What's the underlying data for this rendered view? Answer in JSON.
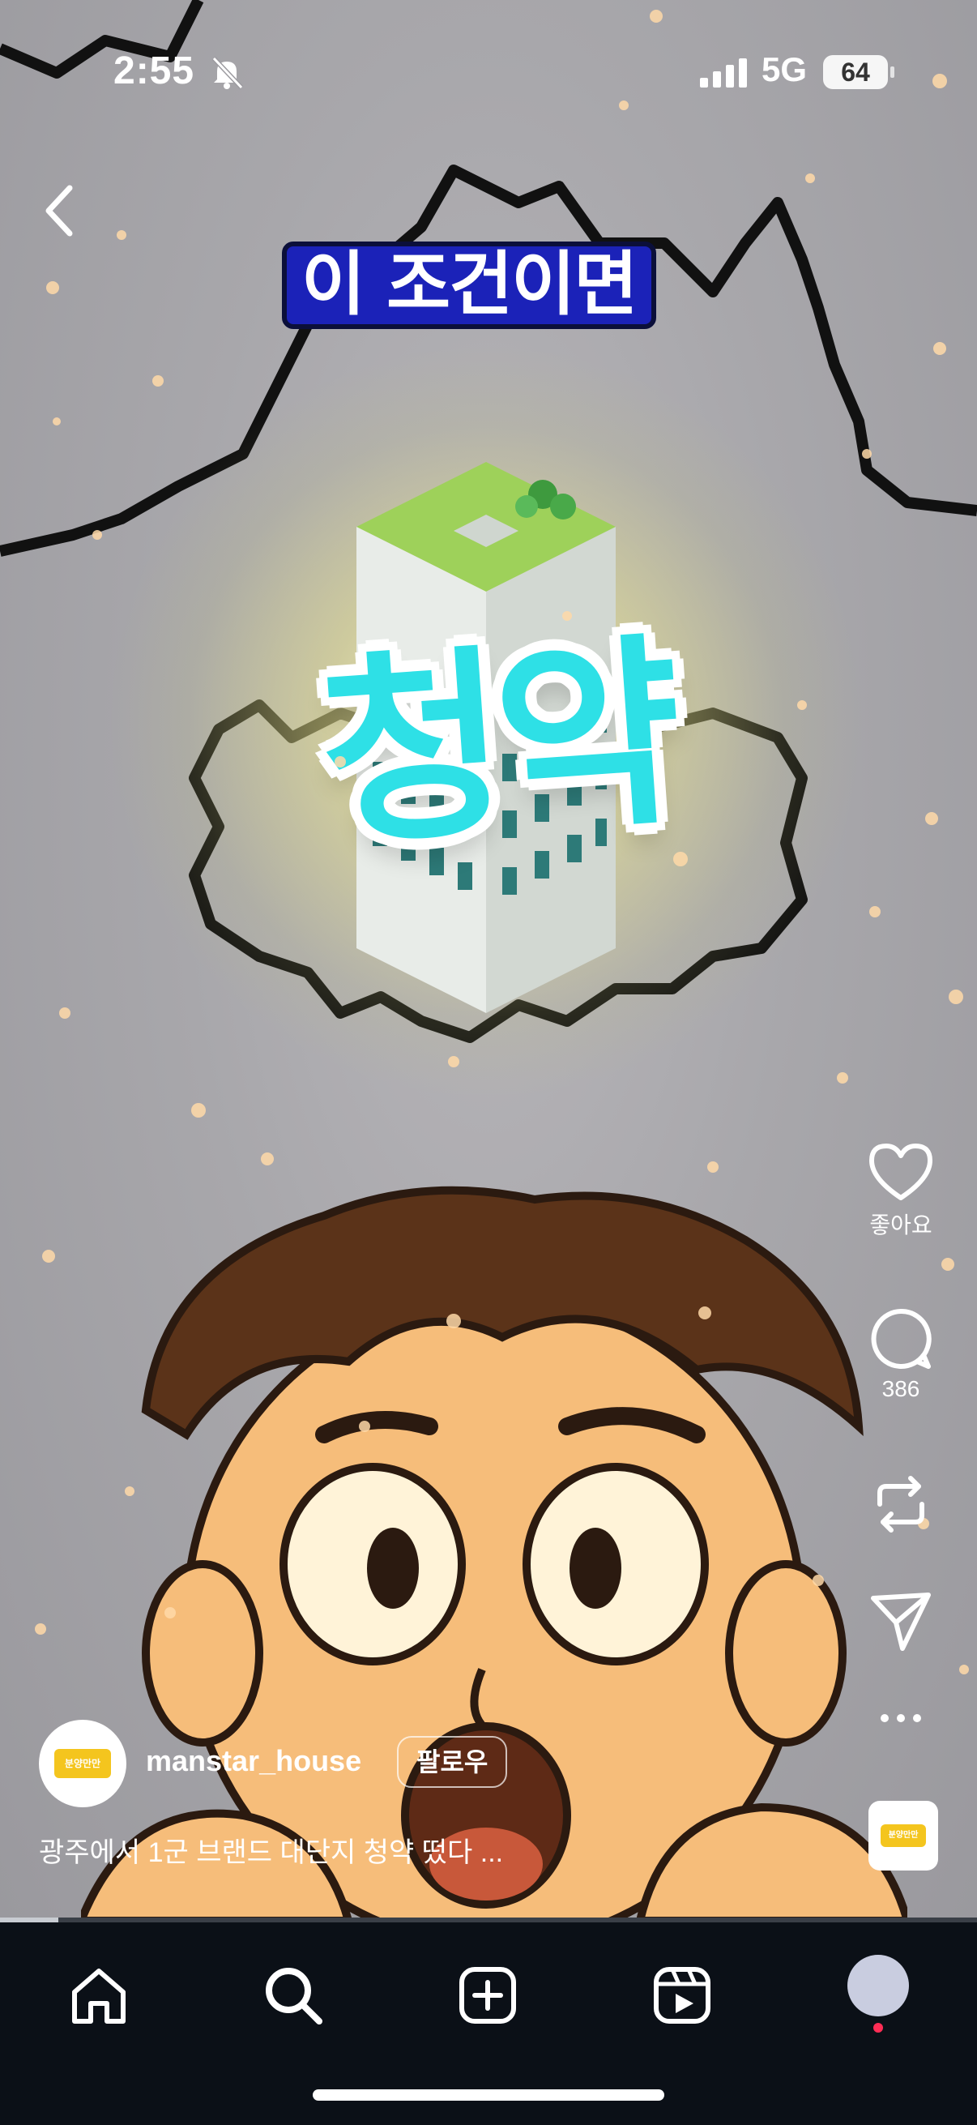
{
  "status_bar": {
    "time": "2:55",
    "network": "5G",
    "battery": "64"
  },
  "video": {
    "headline": "이 조건이면",
    "big_word": "청약"
  },
  "actions": {
    "like_label": "좋아요",
    "comment_count": "386"
  },
  "post": {
    "username": "manstar_house",
    "follow_label": "팔로우",
    "caption": "광주에서 1군 브랜드 대단지 청약 떴다 ...",
    "avatar_text": "분양만만"
  },
  "progress": {
    "fraction": 0.06
  },
  "tabs": [
    "home-tab",
    "search-tab",
    "create-tab",
    "reels-tab",
    "profile-tab"
  ],
  "colors": {
    "headline_bg": "#1b22b8",
    "big_word": "#2ee0e6",
    "avatar_brand": "#f4c51e",
    "notification": "#ff2d55"
  }
}
